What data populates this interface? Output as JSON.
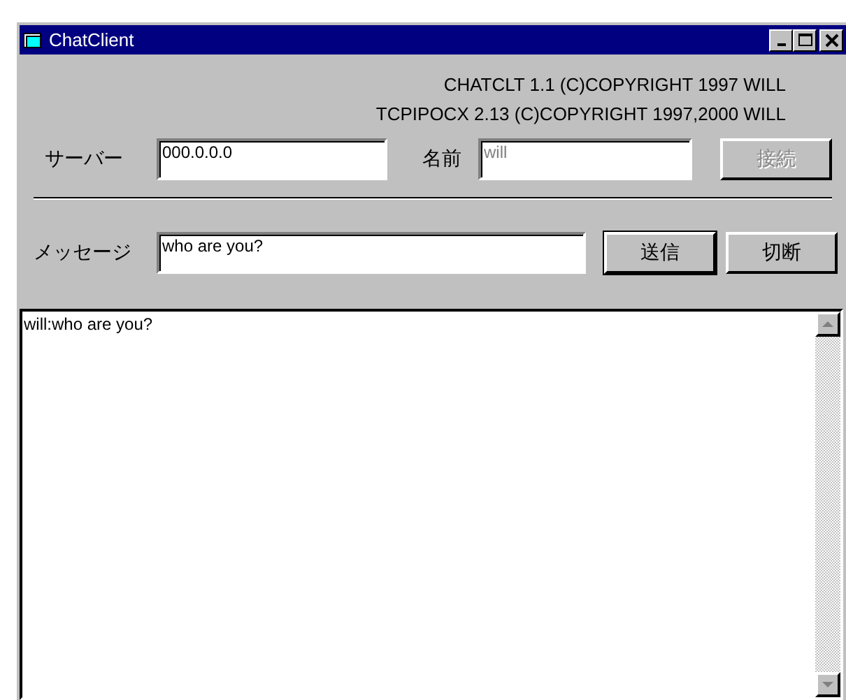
{
  "window": {
    "title": "ChatClient"
  },
  "copyright": [
    "CHATCLT 1.1  (C)COPYRIGHT 1997 WILL",
    "TCPIPOCX  2.13  (C)COPYRIGHT 1997,2000 WILL"
  ],
  "server": {
    "label": "サーバー",
    "value": "000.0.0.0"
  },
  "name": {
    "label": "名前",
    "value": "will",
    "disabled": true
  },
  "connect_button": {
    "label": "接続",
    "disabled": true
  },
  "message": {
    "label": "メッセージ",
    "value": "who are you?"
  },
  "send_button": {
    "label": "送信",
    "default": true
  },
  "disconnect_button": {
    "label": "切断",
    "disabled": false
  },
  "log": [
    "will:who are you?"
  ]
}
